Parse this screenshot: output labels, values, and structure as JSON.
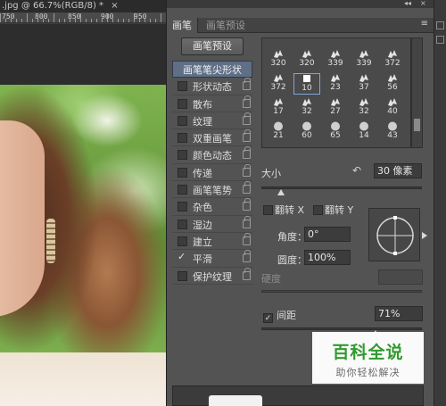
{
  "document": {
    "tab_title": ".jpg @ 66.7%(RGB/8) *",
    "close_glyph": "×",
    "ruler_numbers": [
      "750",
      "800",
      "850",
      "900",
      "950"
    ]
  },
  "panel": {
    "collapse_glyph": "◂◂",
    "close_glyph": "×",
    "tabs": [
      "画笔",
      "画笔预设"
    ],
    "menu_glyph": "≡",
    "preset_button": "画笔预设",
    "brush_tip_header": "画笔笔尖形状",
    "options": [
      {
        "label": "形状动态",
        "checked": false
      },
      {
        "label": "散布",
        "checked": false
      },
      {
        "label": "纹理",
        "checked": false
      },
      {
        "label": "双重画笔",
        "checked": false
      },
      {
        "label": "颜色动态",
        "checked": false
      },
      {
        "label": "传递",
        "checked": false
      },
      {
        "label": "画笔笔势",
        "checked": false
      },
      {
        "label": "杂色",
        "checked": false
      },
      {
        "label": "湿边",
        "checked": false
      },
      {
        "label": "建立",
        "checked": false
      },
      {
        "label": "平滑",
        "checked": true
      },
      {
        "label": "保护纹理",
        "checked": false
      }
    ],
    "check_glyph": "✓",
    "tip_sizes": [
      "320",
      "320",
      "339",
      "339",
      "372",
      "372",
      "10",
      "23",
      "37",
      "56",
      "17",
      "32",
      "27",
      "32",
      "40",
      "21",
      "60",
      "65",
      "14",
      "43"
    ],
    "selected_tip_index": 6,
    "size_label": "大小",
    "size_value": "30 像素",
    "reset_glyph": "↶",
    "size_fraction": 0.12,
    "flip_x_label": "翻转 X",
    "flip_y_label": "翻转 Y",
    "angle_label": "角度：",
    "angle_value": "0°",
    "roundness_label": "圆度：",
    "roundness_value": "100%",
    "hardness_label": "硬度",
    "spacing_label": "间距",
    "spacing_value": "71%",
    "spacing_fraction": 0.71
  },
  "watermark": {
    "title": "百科全说",
    "subtitle": "助你轻松解决"
  }
}
